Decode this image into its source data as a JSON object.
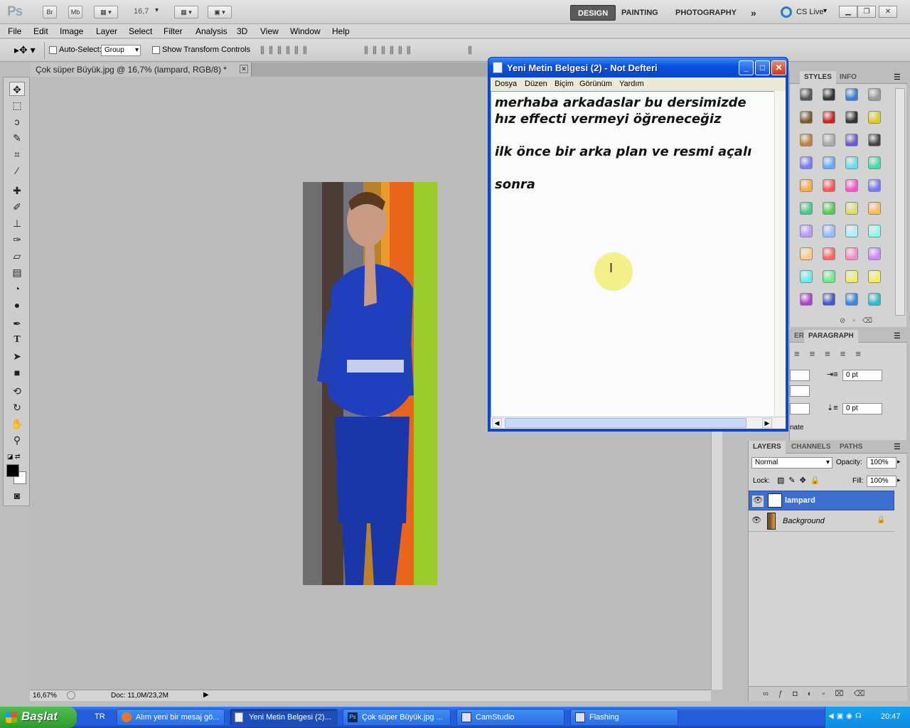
{
  "app": {
    "logo": "Ps",
    "bridge_btn": "Br",
    "minibridge_btn": "Mb",
    "zoom_value": "16,7",
    "workspaces": [
      "DESIGN",
      "PAINTING",
      "PHOTOGRAPHY"
    ],
    "more_workspaces": "»",
    "cslive": "CS Live"
  },
  "menu": [
    "File",
    "Edit",
    "Image",
    "Layer",
    "Select",
    "Filter",
    "Analysis",
    "3D",
    "View",
    "Window",
    "Help"
  ],
  "options": {
    "auto_select_label": "Auto-Select:",
    "auto_select_value": "Group",
    "transform_label": "Show Transform Controls"
  },
  "document": {
    "tab_title": "Çok süper Büyük.jpg @ 16,7% (lampard, RGB/8) *",
    "zoom_status": "16,67%",
    "doc_info": "Doc: 11,0M/23,2M"
  },
  "swatches_panel": {
    "tabs": [
      "STYLES",
      "INFO"
    ],
    "colors": [
      "#555555",
      "#333333",
      "#3a7bd5",
      "#9a9a9a",
      "#7a5a2a",
      "#cc2222",
      "#333333",
      "#ddcc22",
      "#c08040",
      "#aaaaaa",
      "#6a5acd",
      "#444444",
      "#7b7bff",
      "#66aaff",
      "#66e0ee",
      "#44ddaa",
      "#ffaa44",
      "#ff5555",
      "#ff55cc",
      "#7777ff",
      "#44cc88",
      "#55cc55",
      "#dddd66",
      "#ffbb55",
      "#bb99ff",
      "#99bbff",
      "#aaeeff",
      "#88ffee",
      "#ffcc88",
      "#ff6666",
      "#ff88cc",
      "#cc88ff",
      "#66eeee",
      "#66ee88",
      "#eeee66",
      "#ffee55",
      "#aa44cc",
      "#4455cc",
      "#3388dd",
      "#33bbcc"
    ]
  },
  "paragraph_panel": {
    "tabs": [
      "ER",
      "PARAGRAPH"
    ],
    "indent_value_1": "0 pt",
    "indent_value_2": "0 pt",
    "footer_text": "nate"
  },
  "layers_panel": {
    "tabs": [
      "LAYERS",
      "CHANNELS",
      "PATHS"
    ],
    "blend_mode": "Normal",
    "opacity_label": "Opacity:",
    "opacity_value": "100%",
    "lock_label": "Lock:",
    "fill_label": "Fill:",
    "fill_value": "100%",
    "layers": [
      {
        "name": "lampard",
        "selected": true
      },
      {
        "name": "Background",
        "selected": false
      }
    ]
  },
  "notepad": {
    "title": "Yeni Metin Belgesi (2) - Not Defteri",
    "menu": [
      "Dosya",
      "Düzen",
      "Biçim",
      "Görünüm",
      "Yardım"
    ],
    "content": "merhaba arkadaslar bu dersimizde\nhız effecti vermeyi öğreneceğiz\n\nilk önce bir arka plan ve resmi açalı\n\nsonra"
  },
  "taskbar": {
    "start": "Başlat",
    "lang": "TR",
    "tasks": [
      {
        "label": "Alım yeni bir mesaj gö...",
        "icon": "firefox-icon"
      },
      {
        "label": "Yeni Metin Belgesi (2)...",
        "icon": "notepad-icon"
      },
      {
        "label": "Çok süper Büyük.jpg ...",
        "icon": "photoshop-icon"
      },
      {
        "label": "CamStudio",
        "icon": "camstudio-icon"
      },
      {
        "label": "Flashing",
        "icon": "flashing-icon"
      }
    ],
    "clock": "20:47"
  }
}
